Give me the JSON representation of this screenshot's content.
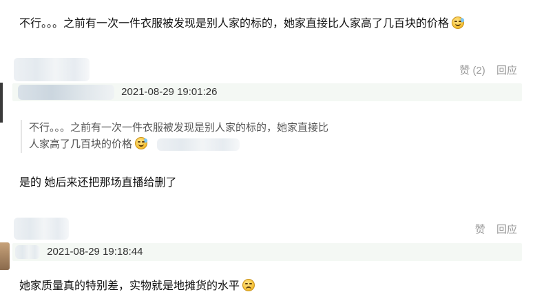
{
  "comments": [
    {
      "text": "不行。。。之前有一次一件衣服被发现是别人家的标的，她家直接比人家高了几百块的价格",
      "like_label": "赞 (2)",
      "reply_label": "回应"
    },
    {
      "timestamp": "2021-08-29 19:01:26",
      "quote_line1": "不行。。。之前有一次一件衣服被发现是别人家的标的，她家直接比",
      "quote_line2": "人家高了几百块的价格",
      "text": "是的 她后来还把那场直播给删了",
      "like_label": "赞",
      "reply_label": "回应"
    },
    {
      "timestamp": "2021-08-29 19:18:44",
      "text": "她家质量真的特别差，实物就是地摊货的水平"
    }
  ],
  "emoji": {
    "sweat_smile": "sweat-smile-emoji",
    "sad": "sad-emoji"
  }
}
